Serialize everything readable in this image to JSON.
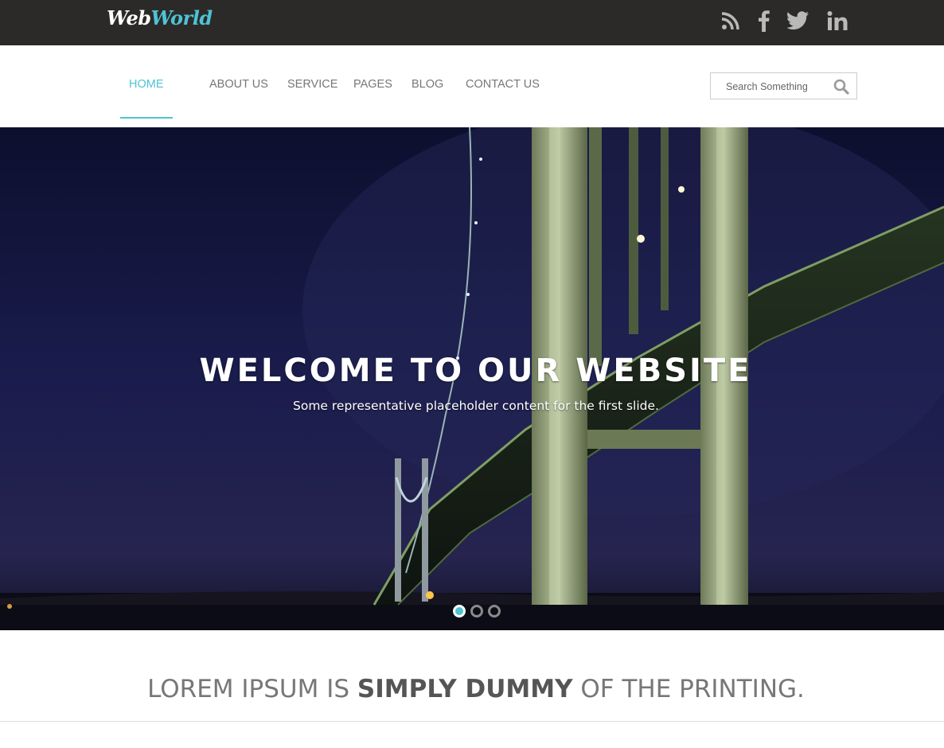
{
  "brand": {
    "part1": "Web",
    "part2": "World",
    "accent": "#4ec3d2"
  },
  "social": {
    "icons": [
      "rss-icon",
      "facebook-icon",
      "twitter-icon",
      "linkedin-icon"
    ]
  },
  "nav": {
    "items": [
      {
        "label": "HOME",
        "active": true
      },
      {
        "label": "ABOUT US"
      },
      {
        "label": "SERVICE"
      },
      {
        "label": "PAGES"
      },
      {
        "label": "BLOG"
      },
      {
        "label": "CONTACT US"
      }
    ]
  },
  "search": {
    "placeholder": "Search Something",
    "icon": "search-icon"
  },
  "hero": {
    "title": "WELCOME TO OUR WEBSITE",
    "subtitle": "Some representative placeholder content for the first slide.",
    "slides": 3,
    "active_slide": 1
  },
  "tagline": {
    "lead": "LOREM IPSUM IS ",
    "emphasis": "SIMPLY DUMMY",
    "trail": " OF THE PRINTING."
  }
}
